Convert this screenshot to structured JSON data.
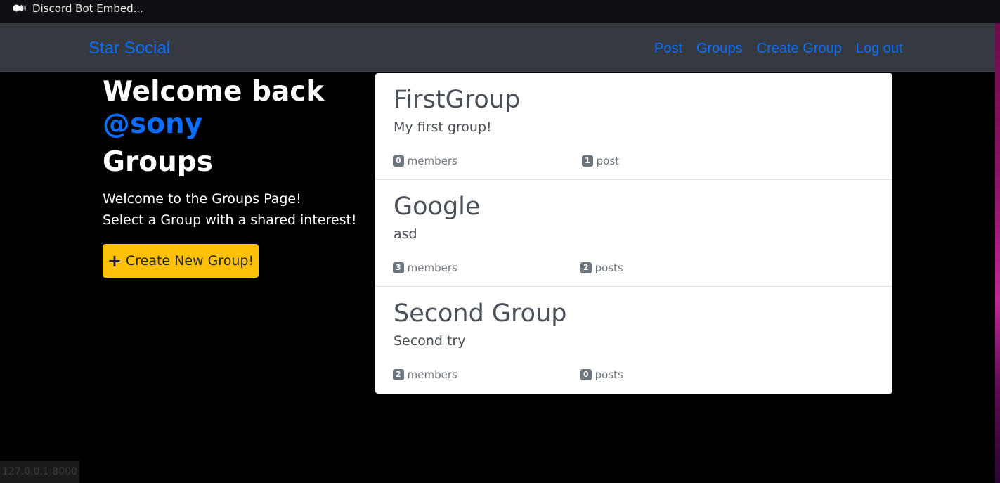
{
  "window": {
    "tab_title": "Discord Bot Embed..."
  },
  "navbar": {
    "brand": "Star Social",
    "links": [
      "Post",
      "Groups",
      "Create Group",
      "Log out"
    ]
  },
  "main": {
    "welcome": "Welcome back",
    "username": "@sony",
    "heading": "Groups",
    "intro_line1": "Welcome to the Groups Page!",
    "intro_line2": "Select a Group with a shared interest!",
    "create_button": "Create New Group!"
  },
  "groups": [
    {
      "name": "FirstGroup",
      "description": "My first group!",
      "members_count": "0",
      "members_label": "members",
      "posts_count": "1",
      "posts_label": "post"
    },
    {
      "name": "Google",
      "description": "asd",
      "members_count": "3",
      "members_label": "members",
      "posts_count": "2",
      "posts_label": "posts"
    },
    {
      "name": "Second Group",
      "description": "Second try",
      "members_count": "2",
      "members_label": "members",
      "posts_count": "0",
      "posts_label": "posts"
    }
  ],
  "status_bar": {
    "url": "127.0.0.1:8000"
  },
  "colors": {
    "link": "#0d6efd",
    "navbar": "#343a40",
    "button": "#ffc107",
    "badge": "#6c757d"
  },
  "icons": {
    "tab": "medium-logo-icon",
    "button": "plus-icon"
  }
}
